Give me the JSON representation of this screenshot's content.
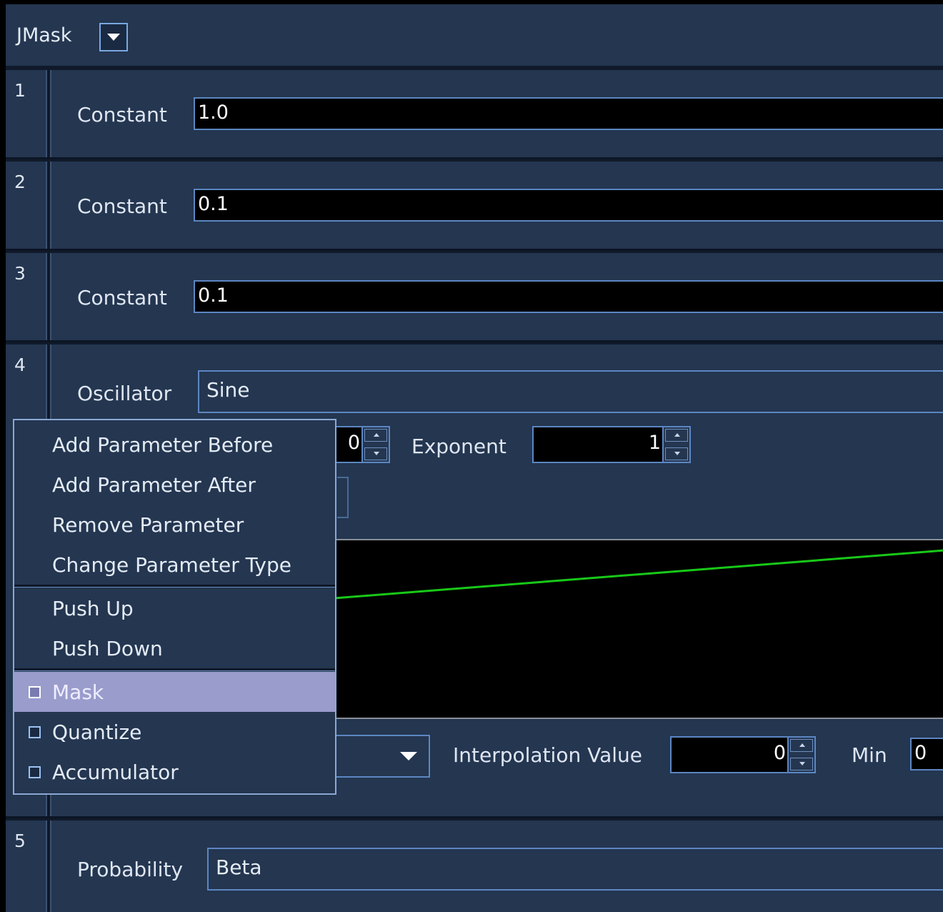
{
  "window": {
    "title": "JMask"
  },
  "params": [
    {
      "index": "1",
      "label": "Constant",
      "value": "1.0"
    },
    {
      "index": "2",
      "label": "Constant",
      "value": "0.1"
    },
    {
      "index": "3",
      "label": "Constant",
      "value": "0.1"
    },
    {
      "index": "4",
      "label": "Oscillator",
      "type": "Sine",
      "partial_spinner_value": "0",
      "exponent_label": "Exponent",
      "exponent_value": "1",
      "interp_label": "Interpolation Value",
      "interp_value": "0",
      "min_label": "Min",
      "min_value": "0"
    },
    {
      "index": "5",
      "label": "Probability",
      "type": "Beta"
    }
  ],
  "context_menu": {
    "items": [
      "Add Parameter Before",
      "Add Parameter After",
      "Remove Parameter",
      "Change Parameter Type"
    ],
    "move_items": [
      "Push Up",
      "Push Down"
    ],
    "check_items": [
      {
        "label": "Mask",
        "checked": false,
        "highlighted": true
      },
      {
        "label": "Quantize",
        "checked": false
      },
      {
        "label": "Accumulator",
        "checked": false
      }
    ]
  },
  "colors": {
    "background": "#243650",
    "accent": "#5c86c2",
    "graph_line": "#18c818",
    "highlight": "#9a9ccc"
  }
}
